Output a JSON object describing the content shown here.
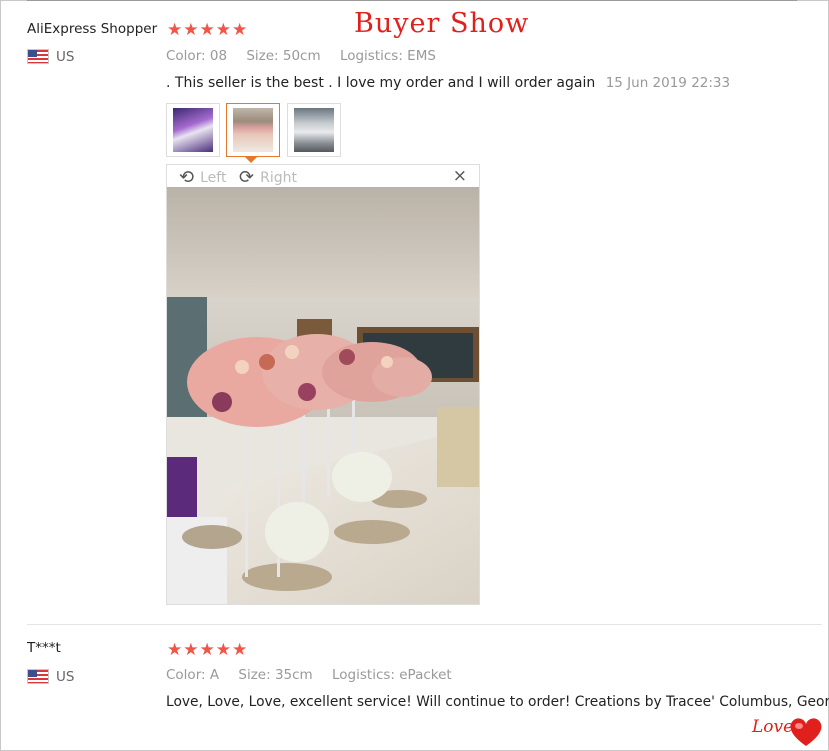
{
  "headline": "Buyer Show",
  "reviews": [
    {
      "name": "AliExpress Shopper",
      "country": "US",
      "rating": 5,
      "color": "Color: 08",
      "size": "Size: 50cm",
      "logistics": "Logistics: EMS",
      "text": ". This seller is the best . I love my order and I will order again",
      "date": "15 Jun 2019 22:33"
    },
    {
      "name": "T***t",
      "country": "US",
      "rating": 5,
      "color": "Color: A",
      "size": "Size: 35cm",
      "logistics": "Logistics: ePacket",
      "text": "Love, Love, Love, excellent service! Will continue to order! Creations by Tracee' Columbus, Georgia"
    }
  ],
  "viewer": {
    "rotate_left_label": "Left",
    "rotate_right_label": "Right",
    "close_icon": "×"
  },
  "icons": {
    "star": "★",
    "rotate_left": "⟲",
    "rotate_right": "⟳",
    "heart": "heart-icon"
  },
  "decor": {
    "love_text": "Love"
  },
  "colors": {
    "accent": "#e6782b",
    "star": "#f05548",
    "headline": "#e0201c"
  }
}
